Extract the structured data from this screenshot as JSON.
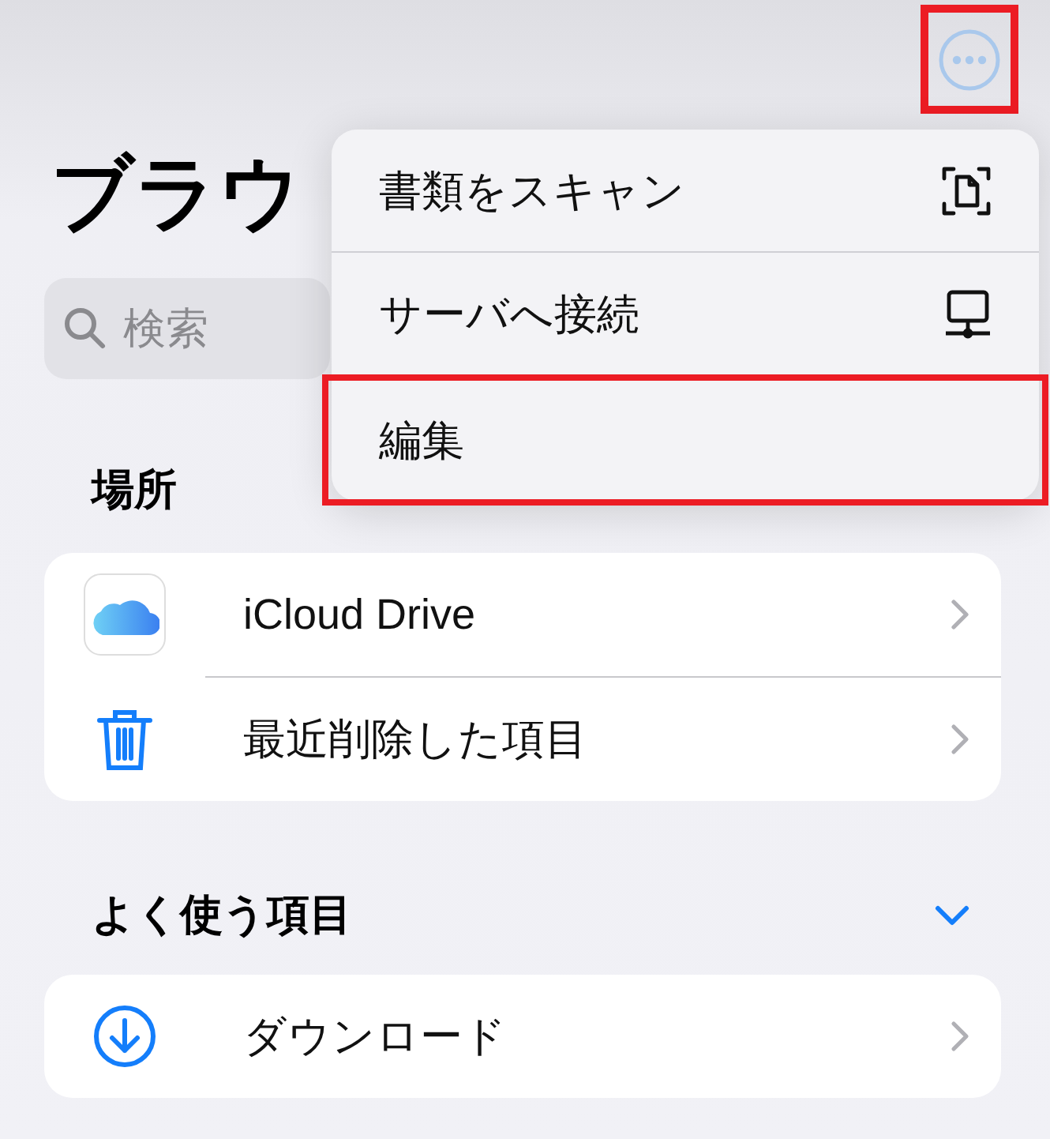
{
  "more_button": {
    "highlighted": true
  },
  "title": "ブラウ",
  "search": {
    "placeholder": "検索"
  },
  "sections": [
    {
      "header": "場所",
      "items": [
        {
          "label": "iCloud Drive",
          "kind": "icloud"
        },
        {
          "label": "最近削除した項目",
          "kind": "trash"
        }
      ]
    },
    {
      "header": "よく使う項目",
      "expanded": true,
      "items": [
        {
          "label": "ダウンロード",
          "kind": "download"
        }
      ]
    }
  ],
  "menu": [
    {
      "label": "書類をスキャン",
      "kind": "scan",
      "highlighted": false
    },
    {
      "label": "サーバへ接続",
      "kind": "server",
      "highlighted": false
    },
    {
      "label": "編集",
      "kind": "plain",
      "highlighted": true
    }
  ]
}
